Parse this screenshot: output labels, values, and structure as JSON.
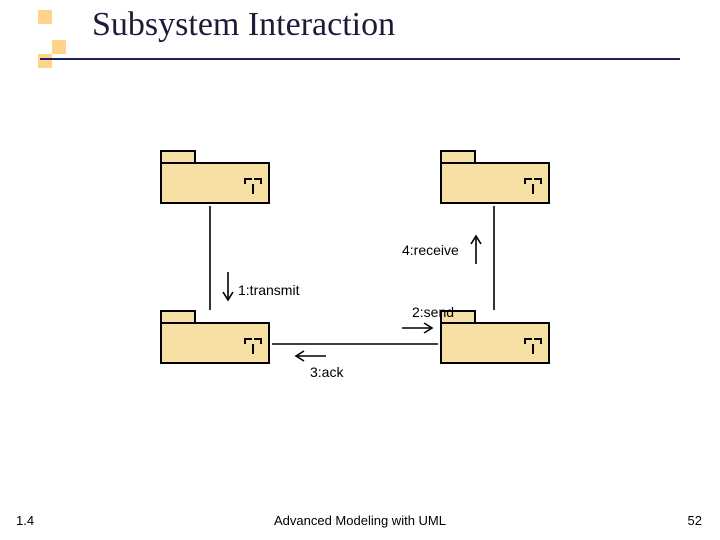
{
  "title": "Subsystem Interaction",
  "chart_data": {
    "type": "diagram",
    "subtype": "uml_collaboration",
    "nodes": [
      {
        "id": "pkg_top_left",
        "kind": "package",
        "row": 0,
        "col": 0
      },
      {
        "id": "pkg_top_right",
        "kind": "package",
        "row": 0,
        "col": 1
      },
      {
        "id": "pkg_bot_left",
        "kind": "package",
        "row": 1,
        "col": 0
      },
      {
        "id": "pkg_bot_right",
        "kind": "package",
        "row": 1,
        "col": 1
      }
    ],
    "messages": [
      {
        "seq": 1,
        "label": "1:transmit",
        "from": "pkg_top_left",
        "to": "pkg_bot_left",
        "direction": "down"
      },
      {
        "seq": 2,
        "label": "2:send",
        "from": "pkg_bot_left",
        "to": "pkg_bot_right",
        "direction": "right"
      },
      {
        "seq": 3,
        "label": "3:ack",
        "from": "pkg_bot_right",
        "to": "pkg_bot_left",
        "direction": "left"
      },
      {
        "seq": 4,
        "label": "4:receive",
        "from": "pkg_bot_right",
        "to": "pkg_top_right",
        "direction": "up"
      }
    ]
  },
  "msg": {
    "m1": "1:transmit",
    "m2": "2:send",
    "m3": "3:ack",
    "m4": "4:receive"
  },
  "footer": {
    "version": "1.4",
    "text": "Advanced Modeling with UML",
    "page": "52"
  }
}
